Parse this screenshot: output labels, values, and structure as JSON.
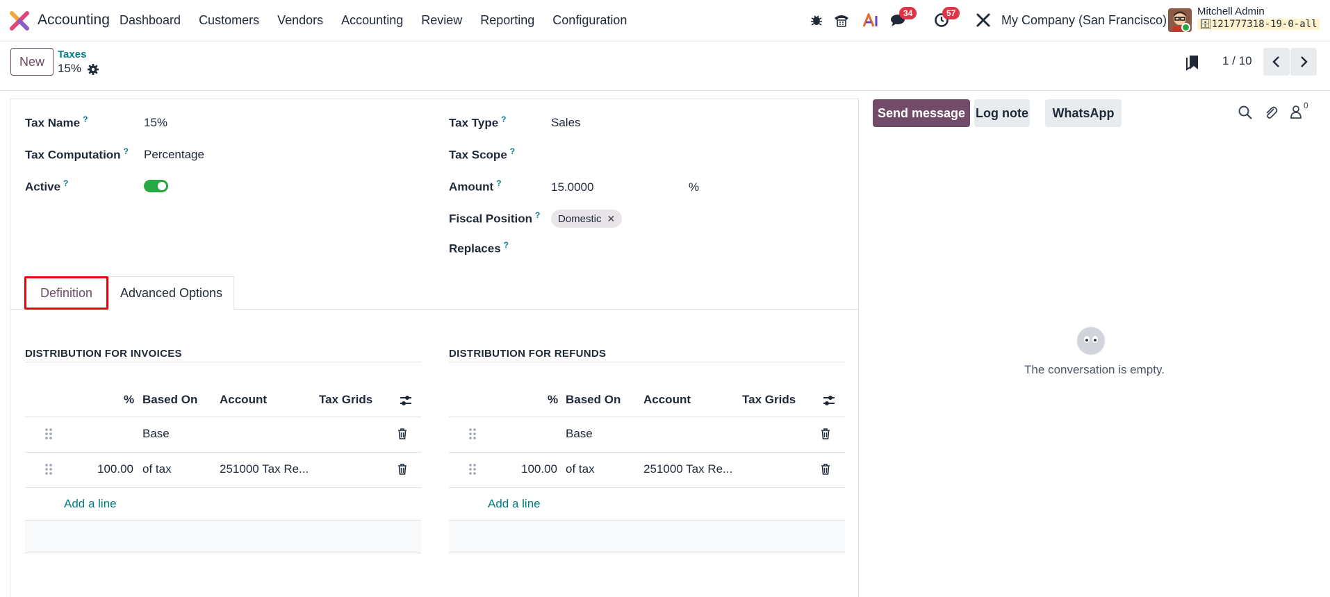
{
  "navbar": {
    "app_name": "Accounting",
    "menu": [
      "Dashboard",
      "Customers",
      "Vendors",
      "Accounting",
      "Review",
      "Reporting",
      "Configuration"
    ],
    "icons": [
      "bug-icon",
      "phone-icon",
      "ai-icon",
      "chat-icon",
      "activity-clock-icon",
      "tools-icon"
    ],
    "messages_badge": "34",
    "activities_badge": "57",
    "company": "My Company (San Francisco)",
    "user_name": "Mitchell Admin",
    "db_name": "121777318-19-0-all"
  },
  "control_panel": {
    "new_label": "New",
    "breadcrumb": "Taxes",
    "record_title": "15%",
    "pager": "1 / 10"
  },
  "form": {
    "tax_name_label": "Tax Name",
    "tax_name_value": "15%",
    "tax_computation_label": "Tax Computation",
    "tax_computation_value": "Percentage",
    "active_label": "Active",
    "active_value": true,
    "tax_type_label": "Tax Type",
    "tax_type_value": "Sales",
    "tax_scope_label": "Tax Scope",
    "tax_scope_value": "",
    "amount_label": "Amount",
    "amount_value": "15.0000",
    "amount_unit": "%",
    "fiscal_position_label": "Fiscal Position",
    "fiscal_position_tag": "Domestic",
    "replaces_label": "Replaces",
    "help_mark": "?"
  },
  "tabs": [
    "Definition",
    "Advanced Options"
  ],
  "invoices": {
    "title": "DISTRIBUTION FOR INVOICES",
    "headers": [
      "%",
      "Based On",
      "Account",
      "Tax Grids"
    ],
    "rows": [
      {
        "percent": "",
        "based_on": "Base",
        "account": "",
        "tax_grids": ""
      },
      {
        "percent": "100.00",
        "based_on": "of tax",
        "account": "251000 Tax Re...",
        "tax_grids": ""
      }
    ],
    "add_line": "Add a line"
  },
  "refunds": {
    "title": "DISTRIBUTION FOR REFUNDS",
    "headers": [
      "%",
      "Based On",
      "Account",
      "Tax Grids"
    ],
    "rows": [
      {
        "percent": "",
        "based_on": "Base",
        "account": "",
        "tax_grids": ""
      },
      {
        "percent": "100.00",
        "based_on": "of tax",
        "account": "251000 Tax Re...",
        "tax_grids": ""
      }
    ],
    "add_line": "Add a line"
  },
  "chatter": {
    "send_message": "Send message",
    "log_note": "Log note",
    "whatsapp": "WhatsApp",
    "followers_count": "0",
    "empty_text": "The conversation is empty."
  },
  "colors": {
    "brand": "#714b67",
    "link": "#017e84",
    "toggle_on": "#28a745",
    "badge": "#dc3545",
    "highlight_box": "#e8000b"
  }
}
